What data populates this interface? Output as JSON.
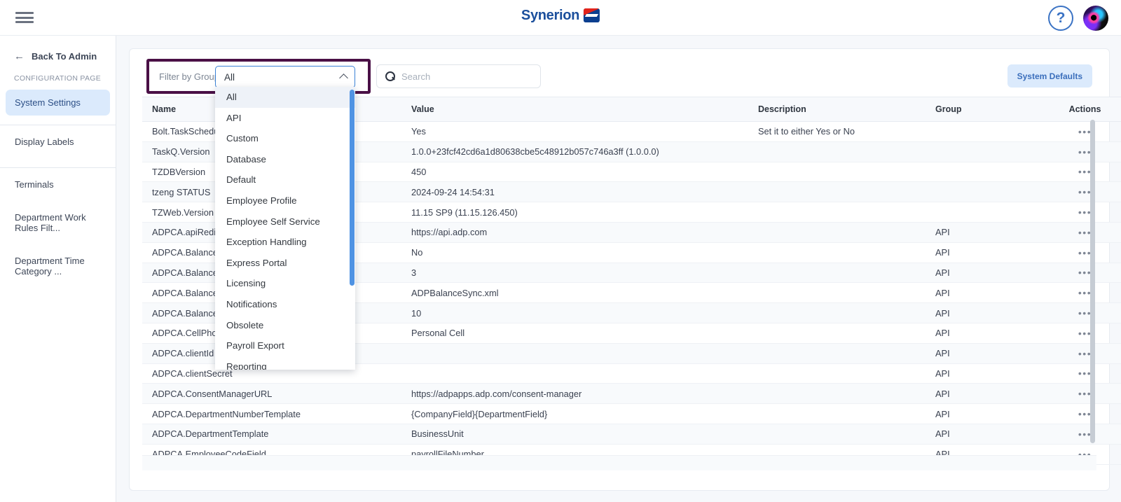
{
  "header": {
    "menu_icon": "hamburger-icon",
    "brand": "Synerion",
    "help_icon": "?",
    "avatar_icon": "user-avatar"
  },
  "sidebar": {
    "back_label": "Back To Admin",
    "back_arrow": "←",
    "section_title": "CONFIGURATION PAGE",
    "items": [
      {
        "label": "System Settings",
        "active": true
      },
      {
        "label": "Display Labels",
        "active": false
      },
      {
        "label": "Terminals",
        "active": false
      },
      {
        "label": "Department Work Rules Filt...",
        "active": false
      },
      {
        "label": "Department Time Category ...",
        "active": false
      }
    ]
  },
  "toolbar": {
    "filter_label": "Filter by Group",
    "filter_value": "All",
    "search_placeholder": "Search",
    "search_value": "",
    "system_defaults_label": "System Defaults"
  },
  "dropdown": {
    "open": true,
    "selected": "All",
    "options": [
      "All",
      "API",
      "Custom",
      "Database",
      "Default",
      "Employee Profile",
      "Employee Self Service",
      "Exception Handling",
      "Express Portal",
      "Licensing",
      "Notifications",
      "Obsolete",
      "Payroll Export",
      "Reporting"
    ]
  },
  "table": {
    "columns": [
      "Name",
      "Value",
      "Description",
      "Group",
      "Actions"
    ],
    "action_glyph": "•••",
    "rows": [
      {
        "name": "Bolt.TaskScheduler",
        "value": "Yes",
        "description": "Set it to either Yes or No",
        "group": ""
      },
      {
        "name": "TaskQ.Version",
        "value": "1.0.0+23fcf42cd6a1d80638cbe5c48912b057c746a3ff (1.0.0.0)",
        "description": "",
        "group": ""
      },
      {
        "name": "TZDBVersion",
        "value": "450",
        "description": "",
        "group": ""
      },
      {
        "name": "tzeng STATUS",
        "value": "2024-09-24 14:54:31",
        "description": "",
        "group": ""
      },
      {
        "name": "TZWeb.Version",
        "value": "11.15 SP9 (11.15.126.450)",
        "description": "",
        "group": ""
      },
      {
        "name": "ADPCA.apiRedirectUrl",
        "value": "https://api.adp.com",
        "description": "",
        "group": "API"
      },
      {
        "name": "ADPCA.BalanceSyncEnabled",
        "value": "No",
        "description": "",
        "group": "API"
      },
      {
        "name": "ADPCA.BalanceSyncRetries",
        "value": "3",
        "description": "",
        "group": "API"
      },
      {
        "name": "ADPCA.BalanceSyncFile",
        "value": "ADPBalanceSync.xml",
        "description": "",
        "group": "API"
      },
      {
        "name": "ADPCA.BalanceSyncBatch",
        "value": "10",
        "description": "",
        "group": "API"
      },
      {
        "name": "ADPCA.CellPhoneType",
        "value": "Personal Cell",
        "description": "",
        "group": "API"
      },
      {
        "name": "ADPCA.clientId",
        "value": "",
        "description": "",
        "group": "API"
      },
      {
        "name": "ADPCA.clientSecret",
        "value": "",
        "description": "",
        "group": "API"
      },
      {
        "name": "ADPCA.ConsentManagerURL",
        "value": "https://adpapps.adp.com/consent-manager",
        "description": "",
        "group": "API"
      },
      {
        "name": "ADPCA.DepartmentNumberTemplate",
        "value": "{CompanyField}{DepartmentField}",
        "description": "",
        "group": "API"
      },
      {
        "name": "ADPCA.DepartmentTemplate",
        "value": "BusinessUnit",
        "description": "",
        "group": "API"
      },
      {
        "name": "ADPCA.EmployeeCodeField",
        "value": "payrollFileNumber",
        "description": "",
        "group": "API"
      }
    ]
  },
  "colors": {
    "accent_blue": "#3b82d6",
    "highlight_purple": "#4a1046",
    "brand_blue": "#1b4f9c",
    "brand_red": "#e2231a",
    "active_bg": "#dbeafc"
  }
}
